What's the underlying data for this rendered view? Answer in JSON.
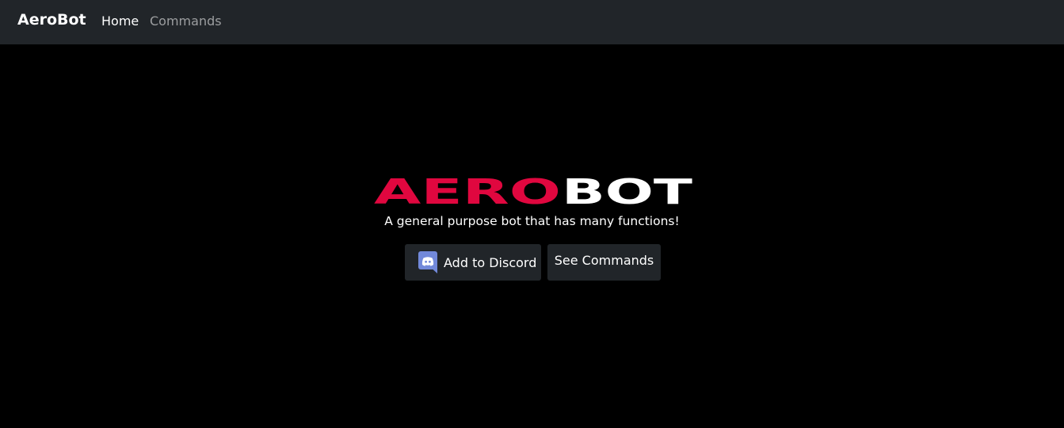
{
  "navbar": {
    "brand": "AeroBot",
    "links": [
      {
        "label": "Home",
        "active": true
      },
      {
        "label": "Commands",
        "active": false
      }
    ]
  },
  "hero": {
    "logo": {
      "part1": "AERO",
      "part2": "BOT",
      "part1_color": "#e0073f",
      "part2_color": "#ffffff"
    },
    "tagline": "A general purpose bot that has many functions!",
    "buttons": {
      "add_to_discord": {
        "label": "Add to Discord",
        "icon": "discord-icon"
      },
      "see_commands": {
        "label": "See Commands"
      }
    }
  },
  "colors": {
    "background": "#000000",
    "navbar": "#212529",
    "button": "#212529",
    "accent": "#e0073f",
    "discord": "#7289da"
  }
}
